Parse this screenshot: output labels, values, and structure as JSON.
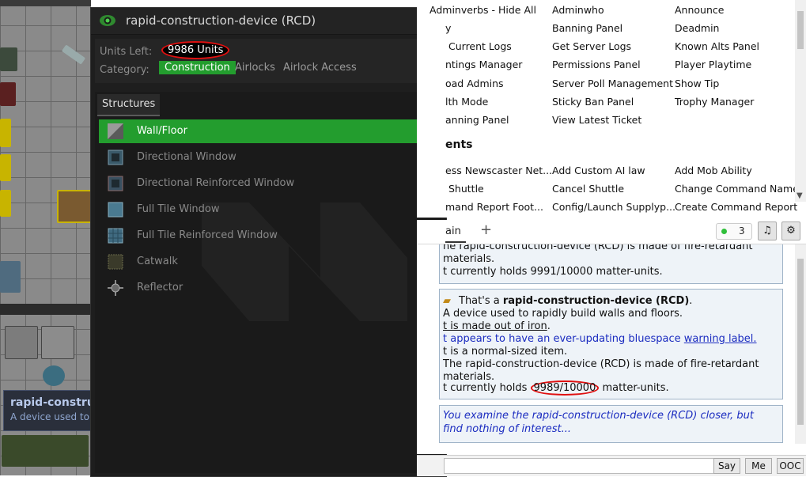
{
  "rcd": {
    "title": "rapid-construction-device (RCD)",
    "close": "✕",
    "units_label": "Units Left:",
    "units_value": "9986 Units",
    "category_label": "Category:",
    "categories": [
      "Construction",
      "Airlocks",
      "Airlock Access"
    ],
    "active_category": "Construction",
    "tab": "Structures",
    "items": [
      "Wall/Floor",
      "Directional Window",
      "Directional Reinforced Window",
      "Full Tile Window",
      "Full Tile Reinforced Window",
      "Catwalk",
      "Reflector"
    ],
    "selected_item": "Wall/Floor",
    "accent": "#239d2e"
  },
  "map_tooltip": {
    "title": "rapid-constru",
    "desc": "A device used to"
  },
  "verbs": {
    "col1": [
      "Adminverbs - Hide All",
      "y",
      "Current Logs",
      "ntings Manager",
      "oad Admins",
      "lth Mode",
      "anning Panel"
    ],
    "col2": [
      "Adminwho",
      "Banning Panel",
      "Get Server Logs",
      "Permissions Panel",
      "Server Poll Management",
      "Sticky Ban Panel",
      "View Latest Ticket"
    ],
    "col3": [
      "Announce",
      "Deadmin",
      "Known Alts Panel",
      "Player Playtime",
      "Show Tip",
      "Trophy Manager"
    ],
    "heading": "ents",
    "events_col1": [
      "ess Newscaster Net...",
      "Shuttle",
      "mand Report Foot..."
    ],
    "events_col2": [
      "Add Custom AI law",
      "Cancel Shuttle",
      "Config/Launch Supplyp..."
    ],
    "events_col3": [
      "Add Mob Ability",
      "Change Command Name",
      "Create Command Report"
    ]
  },
  "chat": {
    "tab_main": "ain",
    "tab_add": "+",
    "online_count": "3",
    "music_icon": "♫",
    "gear_icon": "⚙",
    "box1": {
      "line1": "he rapid-construction-device (RCD) is made of fire-retardant",
      "line2": "materials.",
      "line3": "t currently holds 9991/10000 matter-units."
    },
    "box2": {
      "intro": "That's a ",
      "name": "rapid-construction-device (RCD)",
      "period": ".",
      "desc": "A device used to rapidly build walls and floors.",
      "made_of": "t is made out of iron",
      "made_of_end": ".",
      "bluespace": "t appears to have an ever-updating bluespace ",
      "warning_link": "warning label.",
      "size": "t is a normal-sized item.",
      "fire1": "The rapid-construction-device (RCD) is made of fire-retardant",
      "fire2": "materials.",
      "holds_prefix": "t currently holds ",
      "holds_value": "9989/10000",
      "holds_suffix": " matter-units."
    },
    "box3": {
      "line1": "You examine the rapid-construction-device (RCD) closer, but",
      "line2": "find nothing of interest..."
    }
  },
  "input_bar": {
    "say": "Say",
    "me": "Me",
    "ooc": "OOC"
  }
}
